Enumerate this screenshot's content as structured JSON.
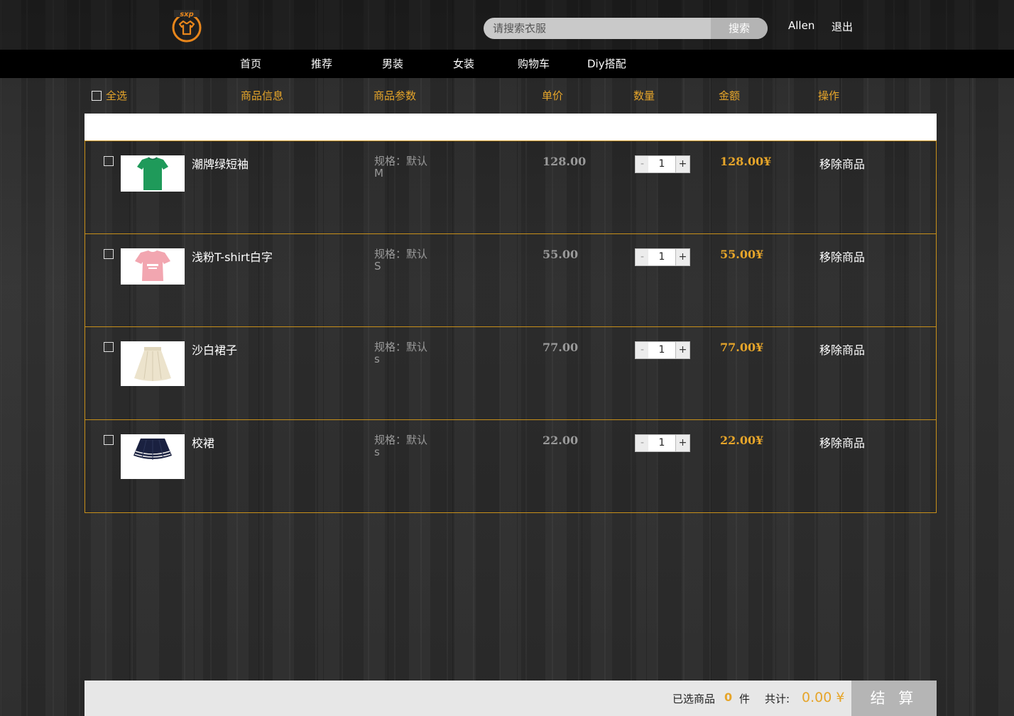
{
  "header": {
    "logo_text": "sxp",
    "search": {
      "placeholder": "请搜索衣服",
      "button_label": "搜索"
    },
    "user_name": "Allen",
    "logout_label": "退出"
  },
  "nav": {
    "items": [
      "首页",
      "推荐",
      "男装",
      "女装",
      "购物车",
      "Diy搭配"
    ]
  },
  "table_header": {
    "select_all": "全选",
    "product_info": "商品信息",
    "product_params": "商品参数",
    "unit_price": "单价",
    "quantity": "数量",
    "amount": "金额",
    "action": "操作"
  },
  "cart": {
    "items": [
      {
        "name": "潮牌绿短袖",
        "spec_label": "规格：默认",
        "size": "M",
        "price": "128.00",
        "qty": "1",
        "amount": "128.00¥",
        "remove_label": "移除商品",
        "image": "green-tshirt",
        "checked": false
      },
      {
        "name": "浅粉T-shirt白字",
        "spec_label": "规格：默认",
        "size": "S",
        "price": "55.00",
        "qty": "1",
        "amount": "55.00¥",
        "remove_label": "移除商品",
        "image": "pink-tshirt",
        "checked": false
      },
      {
        "name": "沙白裙子",
        "spec_label": "规格：默认",
        "size": "s",
        "price": "77.00",
        "qty": "1",
        "amount": "77.00¥",
        "remove_label": "移除商品",
        "image": "white-skirt",
        "checked": false
      },
      {
        "name": "校裙",
        "spec_label": "规格：默认",
        "size": "s",
        "price": "22.00",
        "qty": "1",
        "amount": "22.00¥",
        "remove_label": "移除商品",
        "image": "navy-pleated-skirt",
        "checked": false
      }
    ],
    "qty_minus": "-",
    "qty_plus": "+"
  },
  "footer": {
    "selected_label": "已选商品",
    "selected_count": "0",
    "selected_unit": "件",
    "total_label": "共计:",
    "total_value": "0.00 ¥",
    "checkout_label": "结 算"
  },
  "colors": {
    "accent": "#e6a52a",
    "nav_bg": "#000000",
    "footer_bg": "#e7e7e7",
    "checkout_bg": "#b5b5b5"
  }
}
